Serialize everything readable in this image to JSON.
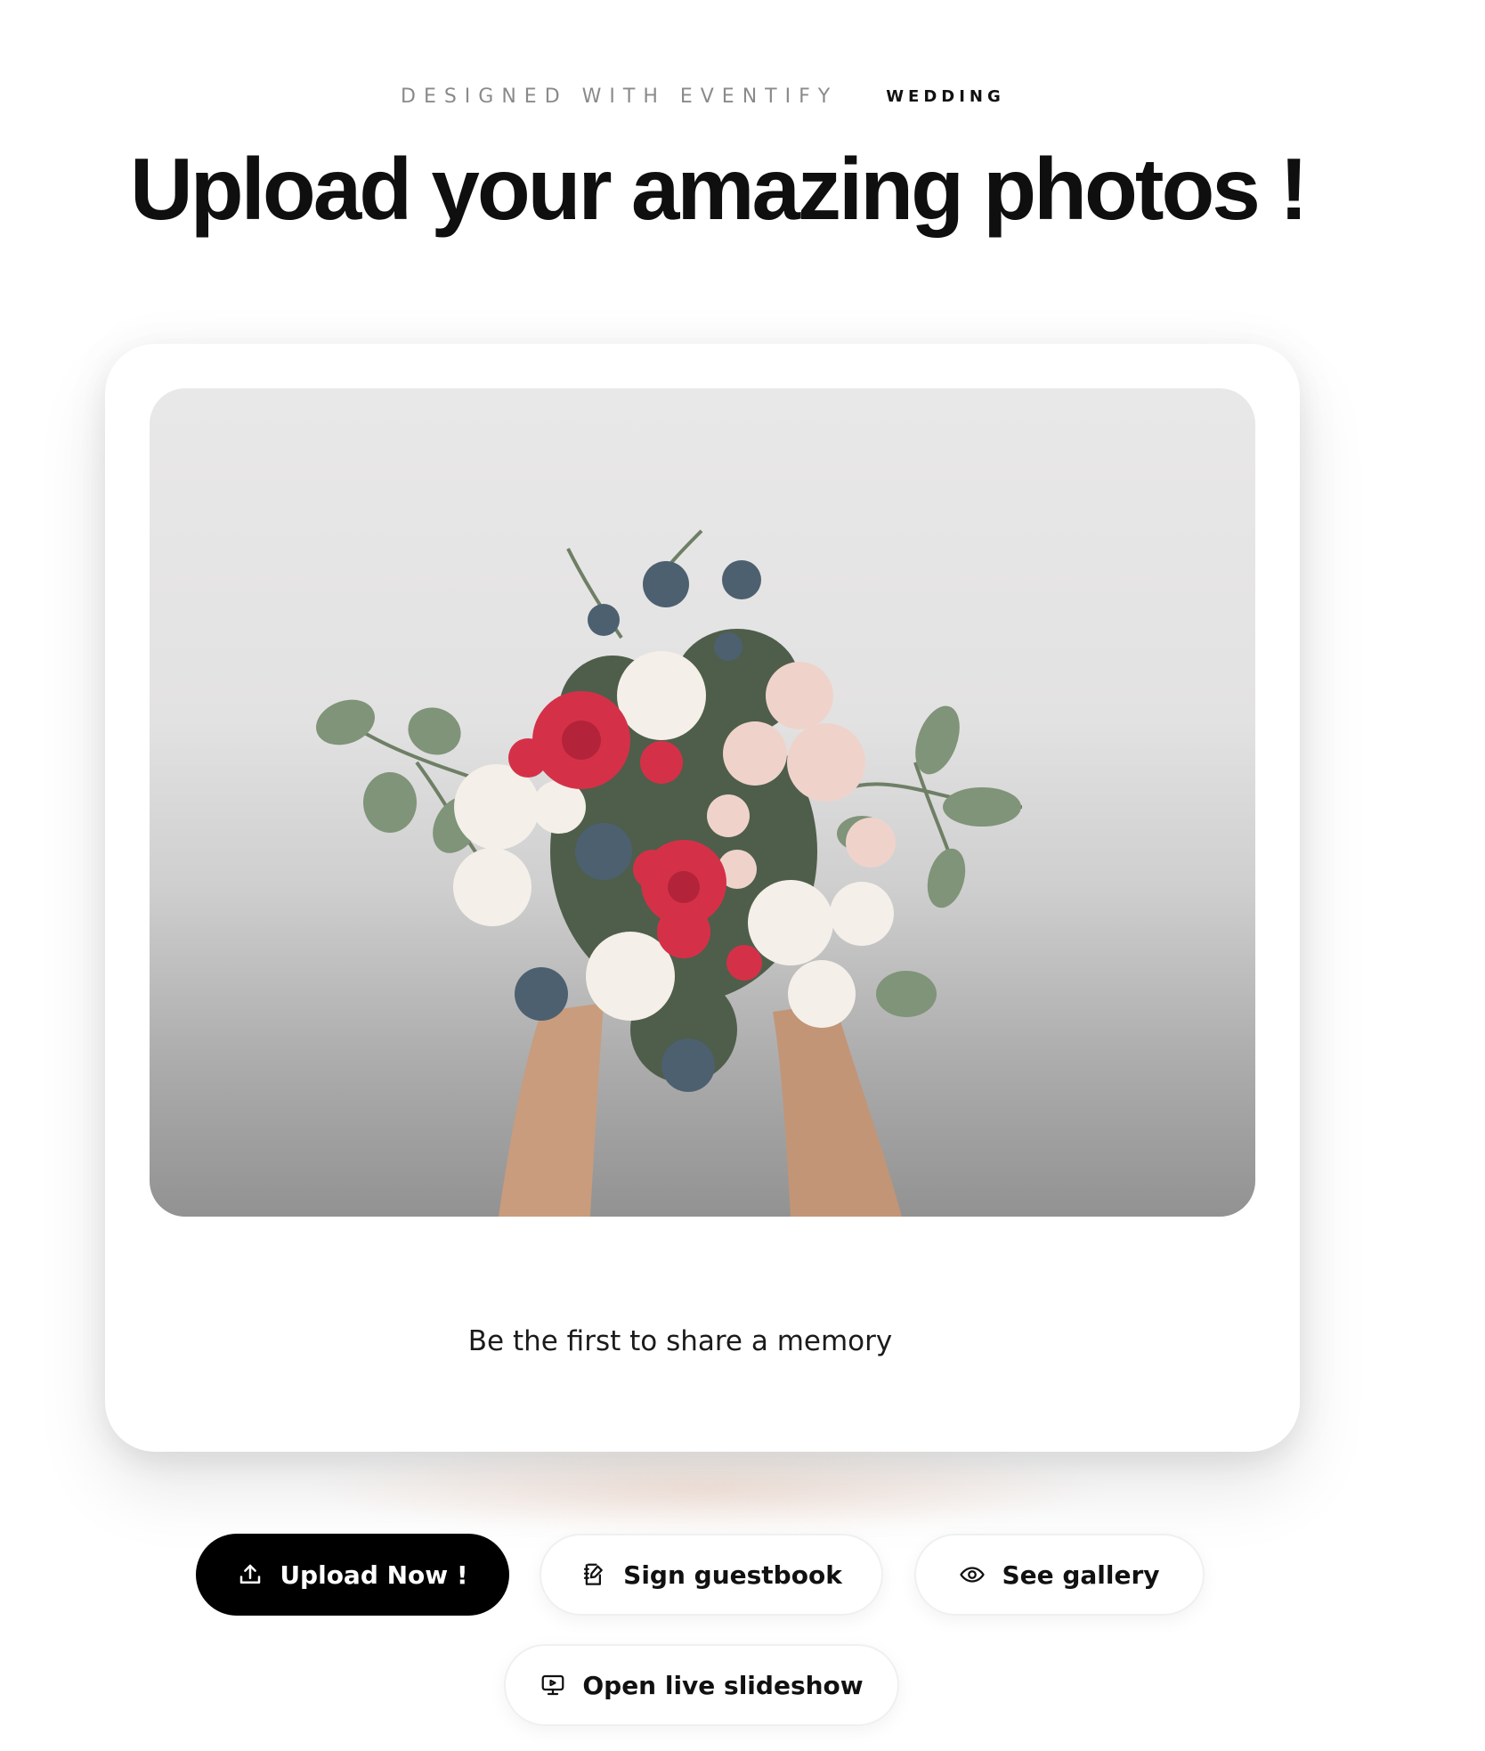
{
  "header": {
    "eyebrow": "DESIGNED WITH EVENTIFY",
    "event_type": "WEDDING",
    "title": "Upload your amazing photos !"
  },
  "card": {
    "photo": "bouquet-photo",
    "caption": "Be the first to share a memory"
  },
  "actions": {
    "upload": {
      "label": "Upload Now !",
      "icon": "upload-icon"
    },
    "guestbook": {
      "label": "Sign guestbook",
      "icon": "guestbook-icon"
    },
    "gallery": {
      "label": "See gallery",
      "icon": "eye-icon"
    },
    "slideshow": {
      "label": "Open live slideshow",
      "icon": "slideshow-icon"
    }
  },
  "colors": {
    "primary_button": "#000000",
    "page_background": "#ffffff",
    "accent_glow": "#f0d2c3"
  }
}
